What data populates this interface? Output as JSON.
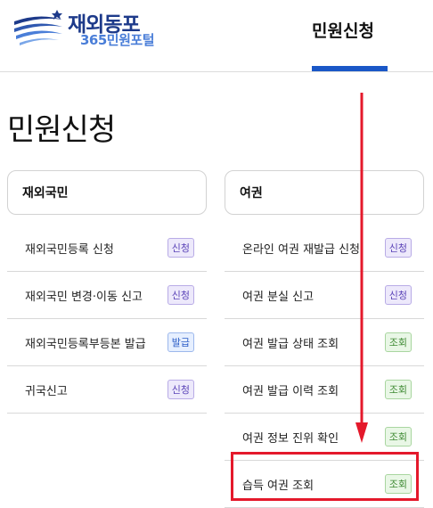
{
  "header": {
    "logo_title": "재외동포",
    "logo_sub": "365민원포털",
    "nav_tab": "민원신청"
  },
  "page": {
    "title": "민원신청"
  },
  "columns": [
    {
      "heading": "재외국민",
      "items": [
        {
          "label": "재외국민등록 신청",
          "badge": "신청",
          "badge_type": "apply"
        },
        {
          "label": "재외국민 변경·이동 신고",
          "badge": "신청",
          "badge_type": "apply"
        },
        {
          "label": "재외국민등록부등본 발급",
          "badge": "발급",
          "badge_type": "issue"
        },
        {
          "label": "귀국신고",
          "badge": "신청",
          "badge_type": "apply"
        }
      ]
    },
    {
      "heading": "여권",
      "items": [
        {
          "label": "온라인 여권 재발급 신청",
          "badge": "신청",
          "badge_type": "apply"
        },
        {
          "label": "여권 분실 신고",
          "badge": "신청",
          "badge_type": "apply"
        },
        {
          "label": "여권 발급 상태 조회",
          "badge": "조회",
          "badge_type": "view"
        },
        {
          "label": "여권 발급 이력 조회",
          "badge": "조회",
          "badge_type": "view"
        },
        {
          "label": "여권 정보 진위 확인",
          "badge": "조회",
          "badge_type": "view"
        },
        {
          "label": "습득 여권 조회",
          "badge": "조회",
          "badge_type": "view"
        }
      ]
    }
  ],
  "colors": {
    "brand_dark": "#1d3a8a",
    "brand_light": "#4a7ed8",
    "nav_accent": "#1a57c7",
    "annotation_red": "#e4192b"
  }
}
